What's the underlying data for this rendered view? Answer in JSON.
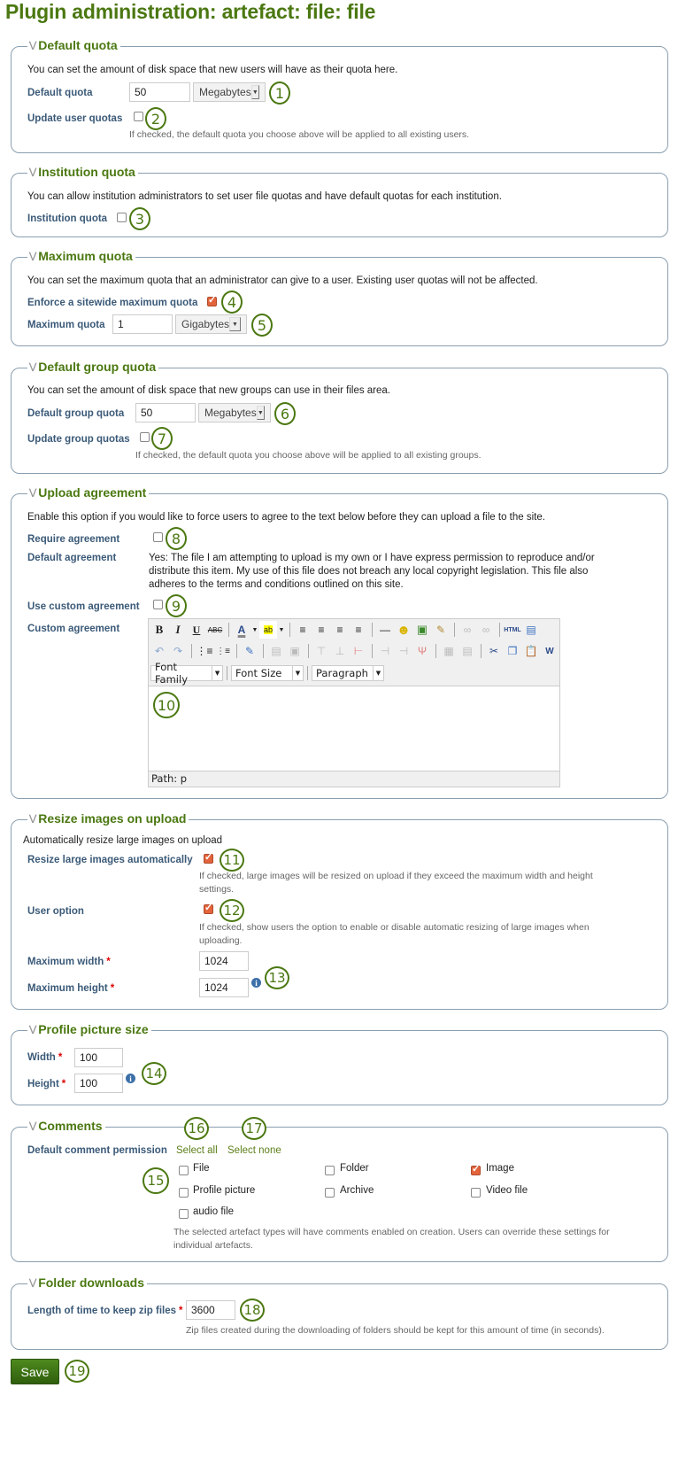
{
  "page": {
    "title": "Plugin administration: artefact: file: file"
  },
  "callouts": [
    "1",
    "2",
    "3",
    "4",
    "5",
    "6",
    "7",
    "8",
    "9",
    "10",
    "11",
    "12",
    "13",
    "14",
    "15",
    "16",
    "17",
    "18",
    "19"
  ],
  "default_quota": {
    "legend": "Default quota",
    "description": "You can set the amount of disk space that new users will have as their quota here.",
    "quota_label": "Default quota",
    "quota_value": "50",
    "quota_unit": "Megabytes",
    "update_label": "Update user quotas",
    "update_checked": false,
    "update_help": "If checked, the default quota you choose above will be applied to all existing users."
  },
  "institution_quota": {
    "legend": "Institution quota",
    "description": "You can allow institution administrators to set user file quotas and have default quotas for each institution.",
    "label": "Institution quota",
    "checked": false
  },
  "maximum_quota": {
    "legend": "Maximum quota",
    "description": "You can set the maximum quota that an administrator can give to a user. Existing user quotas will not be affected.",
    "enforce_label": "Enforce a sitewide maximum quota",
    "enforce_checked": true,
    "max_label": "Maximum quota",
    "max_value": "1",
    "max_unit": "Gigabytes"
  },
  "default_group_quota": {
    "legend": "Default group quota",
    "description": "You can set the amount of disk space that new groups can use in their files area.",
    "quota_label": "Default group quota",
    "quota_value": "50",
    "quota_unit": "Megabytes",
    "update_label": "Update group quotas",
    "update_checked": false,
    "update_help": "If checked, the default quota you choose above will be applied to all existing groups."
  },
  "upload_agreement": {
    "legend": "Upload agreement",
    "description": "Enable this option if you would like to force users to agree to the text below before they can upload a file to the site.",
    "require_label": "Require agreement",
    "require_checked": false,
    "default_label": "Default agreement",
    "default_text_1": "Yes: The file I am attempting to upload is my own or I have express permission to reproduce and/or",
    "default_text_2": "distribute this item. My use of this file does not breach any local copyright legislation. This file also",
    "default_text_3": "adheres to the terms and conditions outlined on this site.",
    "custom_label": "Use custom agreement",
    "custom_checked": false,
    "custom_text_label": "Custom agreement",
    "editor": {
      "font_family": "Font Family",
      "font_size": "Font Size",
      "format": "Paragraph",
      "path": "Path: p",
      "row1": [
        "bold-icon",
        "italic-icon",
        "underline-icon",
        "strikethrough-icon",
        "|",
        "text-color-icon",
        "highlight-color-icon",
        "|",
        "align-left-icon",
        "align-center-icon",
        "align-right-icon",
        "align-justify-icon",
        "|",
        "horizontal-rule-icon",
        "emoticon-icon",
        "image-icon",
        "cleanup-icon",
        "|",
        "link-icon",
        "unlink-icon",
        "|",
        "html-source-icon",
        "fullscreen-icon"
      ],
      "row2": [
        "undo-icon",
        "redo-icon",
        "|",
        "bullet-list-icon",
        "numbered-list-icon",
        "|",
        "edit-table-icon",
        "|",
        "table-row-props-icon",
        "table-cell-props-icon",
        "|",
        "insert-row-before-icon",
        "insert-row-after-icon",
        "delete-row-icon",
        "|",
        "insert-col-before-icon",
        "insert-col-after-icon",
        "delete-col-icon",
        "|",
        "split-cells-icon",
        "merge-cells-icon",
        "|",
        "cut-icon",
        "copy-icon",
        "paste-icon",
        "paste-word-icon"
      ]
    }
  },
  "resize_images": {
    "legend": "Resize images on upload",
    "description": "Automatically resize large images on upload",
    "resize_label": "Resize large images automatically",
    "resize_checked": true,
    "resize_help_1": "If checked, large images will be resized on upload if they exceed the maximum width and height",
    "resize_help_2": "settings.",
    "user_option_label": "User option",
    "user_option_checked": true,
    "user_option_help_1": "If checked, show users the option to enable or disable automatic resizing of large images when",
    "user_option_help_2": "uploading.",
    "max_width_label": "Maximum width",
    "max_width_value": "1024",
    "max_height_label": "Maximum height",
    "max_height_value": "1024"
  },
  "profile_picture": {
    "legend": "Profile picture size",
    "width_label": "Width",
    "width_value": "100",
    "height_label": "Height",
    "height_value": "100"
  },
  "comments": {
    "legend": "Comments",
    "label": "Default comment permission",
    "select_all": "Select all",
    "select_none": "Select none",
    "options": [
      {
        "label": "File",
        "checked": false
      },
      {
        "label": "Folder",
        "checked": false
      },
      {
        "label": "Image",
        "checked": true
      },
      {
        "label": "Profile picture",
        "checked": false
      },
      {
        "label": "Archive",
        "checked": false
      },
      {
        "label": "Video file",
        "checked": false
      },
      {
        "label": "audio file",
        "checked": false
      }
    ],
    "help_1": "The selected artefact types will have comments enabled on creation. Users can override these settings for",
    "help_2": "individual artefacts."
  },
  "folder_downloads": {
    "legend": "Folder downloads",
    "label": "Length of time to keep zip files",
    "value": "3600",
    "help": "Zip files created during the downloading of folders should be kept for this amount of time (in seconds)."
  },
  "actions": {
    "save": "Save"
  },
  "required_marker": "*"
}
